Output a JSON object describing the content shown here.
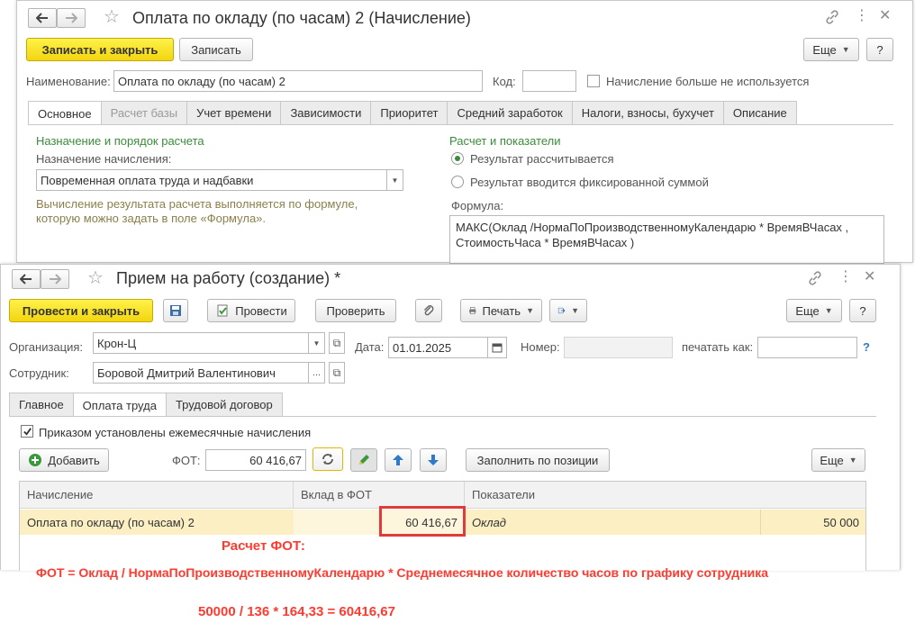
{
  "back_window": {
    "title": "Оплата по окладу (по часам) 2 (Начисление)",
    "toolbar": {
      "save_close": "Записать и закрыть",
      "save": "Записать",
      "more": "Еще",
      "help": "?"
    },
    "name_label": "Наименование:",
    "name_value": "Оплата по окладу (по часам) 2",
    "code_label": "Код:",
    "code_value": "",
    "unused_checkbox_label": "Начисление больше не используется",
    "tabs": [
      "Основное",
      "Расчет базы",
      "Учет времени",
      "Зависимости",
      "Приоритет",
      "Средний заработок",
      "Налоги, взносы, бухучет",
      "Описание"
    ],
    "section_left_title": "Назначение и порядок расчета",
    "purpose_label": "Назначение начисления:",
    "purpose_value": "Повременная оплата труда и надбавки",
    "hint_line1": "Вычисление результата расчета выполняется по формуле,",
    "hint_line2": "которую можно задать в поле «Формула».",
    "section_right_title": "Расчет и показатели",
    "radio_calculated": "Результат рассчитывается",
    "radio_fixed": "Результат вводится фиксированной суммой",
    "formula_label": "Формула:",
    "formula_line1": "МАКС(Оклад /НормаПоПроизводственномуКалендарю * ВремяВЧасах  ,",
    "formula_line2": "СтоимостьЧаса * ВремяВЧасах )"
  },
  "front_window": {
    "title": "Прием на работу (создание) *",
    "toolbar": {
      "post_close": "Провести и закрыть",
      "post": "Провести",
      "check": "Проверить",
      "print": "Печать",
      "more": "Еще",
      "help": "?"
    },
    "org_label": "Организация:",
    "org_value": "Крон-Ц",
    "date_label": "Дата:",
    "date_value": "01.01.2025",
    "number_label": "Номер:",
    "number_value": "",
    "print_as_label": "печатать как:",
    "print_as_value": "",
    "help_q": "?",
    "employee_label": "Сотрудник:",
    "employee_value": "Боровой Дмитрий Валентинович",
    "tabs": [
      "Главное",
      "Оплата труда",
      "Трудовой договор"
    ],
    "monthly_checkbox_label": "Приказом установлены ежемесячные начисления",
    "add_button": "Добавить",
    "fot_label": "ФОТ:",
    "fot_value": "60 416,67",
    "fill_by_position": "Заполнить по позиции",
    "more2": "Еще",
    "table": {
      "headers": [
        "Начисление",
        "Вклад в ФОТ",
        "Показатели"
      ],
      "row": {
        "accrual": "Оплата по окладу (по часам) 2",
        "contribution": "60 416,67",
        "indicator": "Оклад",
        "indicator_value": "50 000"
      }
    }
  },
  "annotations": {
    "heading": "Расчет ФОТ:",
    "formula": "ФОТ = Оклад  / НормаПоПроизводственномуКалендарю * Среднемесячное количество часов по графику сотрудника",
    "calc": "50000 / 136 * 164,33 = 60416,67"
  },
  "colors": {
    "accent_yellow": "#f2d50f",
    "section_green": "#3a8c3a",
    "annotation_red": "#ff3b30",
    "highlight_row": "#fbefc3"
  }
}
